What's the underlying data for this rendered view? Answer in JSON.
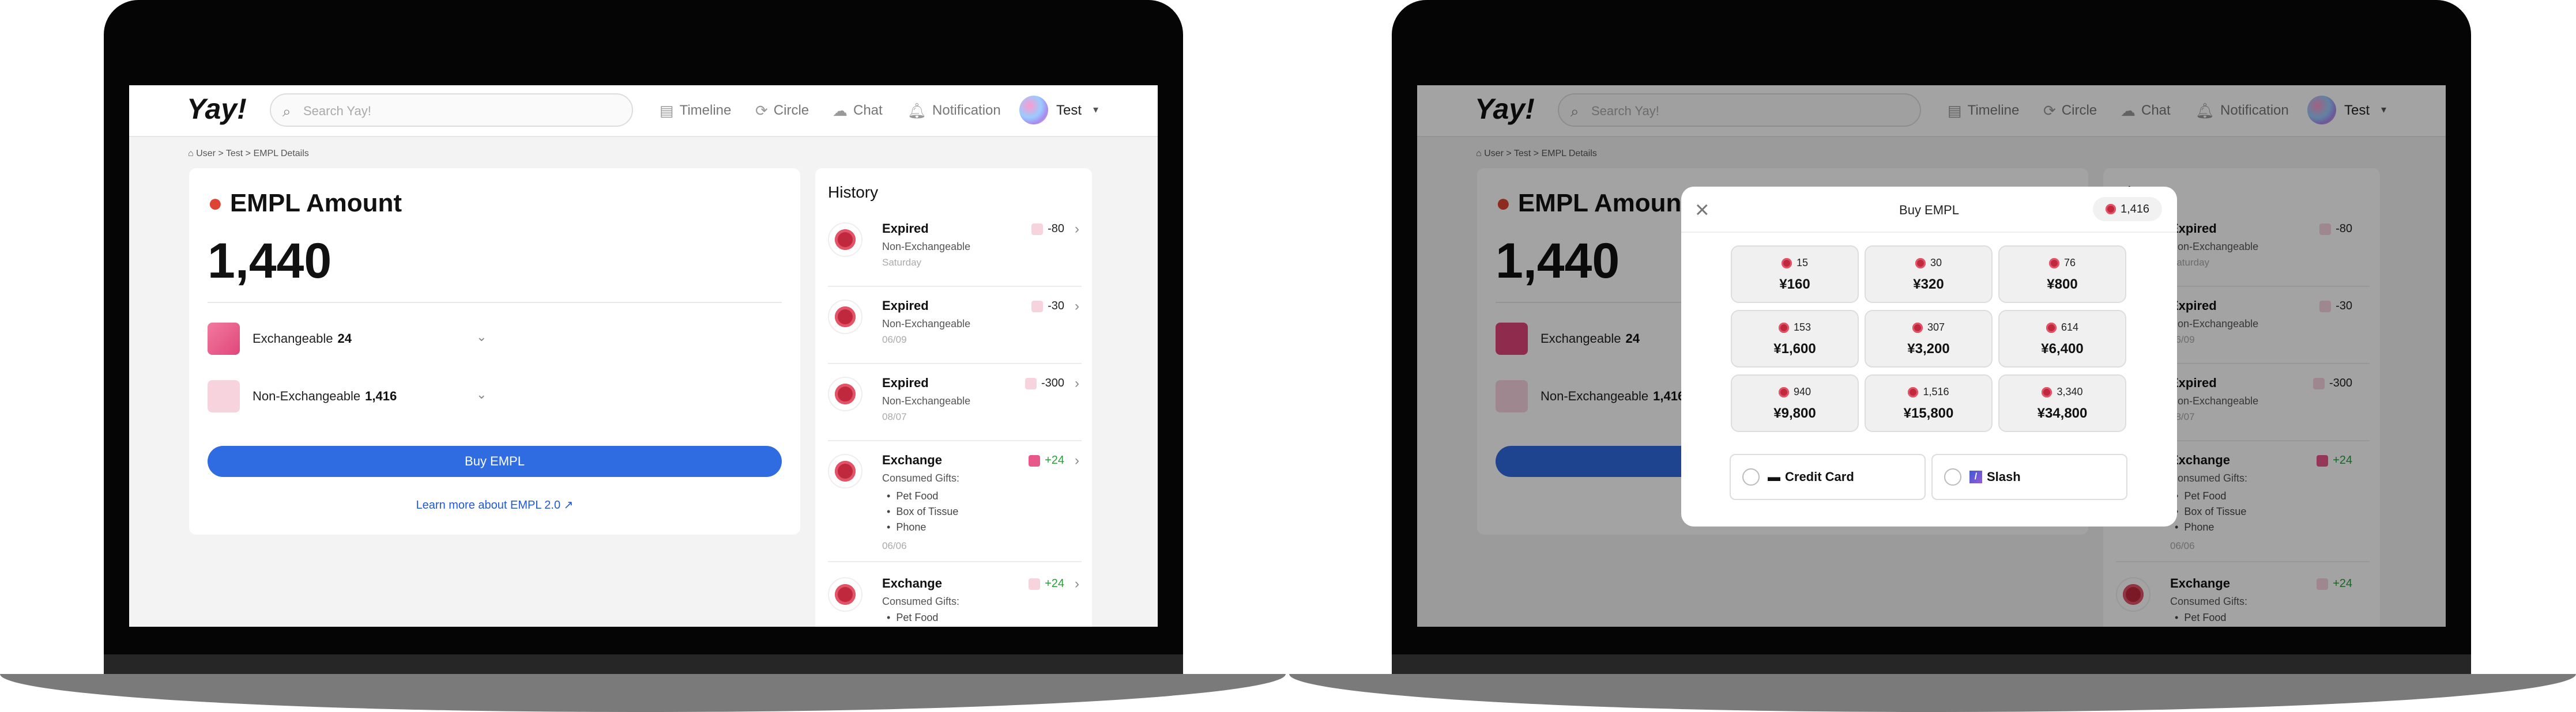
{
  "topbar": {
    "logo": "Yay!",
    "search_placeholder": "Search Yay!",
    "nav": [
      {
        "label": "Timeline",
        "icon": "timeline-icon"
      },
      {
        "label": "Circle",
        "icon": "circle-icon"
      },
      {
        "label": "Chat",
        "icon": "chat-icon"
      },
      {
        "label": "Notification",
        "icon": "bell-icon"
      }
    ],
    "user": "Test"
  },
  "breadcrumb": [
    "User",
    "Test",
    "EMPL Details"
  ],
  "empl": {
    "title": "EMPL Amount",
    "total": "1,440",
    "exchangeable_label": "Exchangeable",
    "exchangeable_value": "24",
    "non_exchangeable_label": "Non-Exchangeable",
    "non_exchangeable_value": "1,416",
    "buy_label": "Buy EMPL",
    "learn_label": "Learn more about EMPL 2.0"
  },
  "history": {
    "title": "History",
    "items": [
      {
        "name": "Expired",
        "sub": "Non-Exchangeable",
        "date": "Saturday",
        "amount": "-80"
      },
      {
        "name": "Expired",
        "sub": "Non-Exchangeable",
        "date": "06/09",
        "amount": "-30"
      },
      {
        "name": "Expired",
        "sub": "Non-Exchangeable",
        "date": "08/07",
        "amount": "-300"
      },
      {
        "name": "Exchange",
        "sub": "Consumed Gifts:",
        "gifts": [
          "Pet Food",
          "Box of Tissue",
          "Phone"
        ],
        "date": "06/06",
        "amount": "+24"
      },
      {
        "name": "Exchange",
        "sub": "Consumed Gifts:",
        "gifts": [
          "Pet Food"
        ],
        "date": "",
        "amount": "+24"
      }
    ]
  },
  "modal": {
    "title": "Buy EMPL",
    "balance": "1,416",
    "options": [
      {
        "amount": "15",
        "price": "¥160"
      },
      {
        "amount": "30",
        "price": "¥320"
      },
      {
        "amount": "76",
        "price": "¥800"
      },
      {
        "amount": "153",
        "price": "¥1,600"
      },
      {
        "amount": "307",
        "price": "¥3,200"
      },
      {
        "amount": "614",
        "price": "¥6,400"
      },
      {
        "amount": "940",
        "price": "¥9,800"
      },
      {
        "amount": "1,516",
        "price": "¥15,800"
      },
      {
        "amount": "3,340",
        "price": "¥34,800"
      }
    ],
    "payment": {
      "credit": "Credit Card",
      "slash": "Slash"
    }
  },
  "colors": {
    "accent": "#2f6be1",
    "positive": "#2a9d3a",
    "exchangeable": "#e8578a",
    "non_exchangeable": "#f7ced9",
    "coin": "#c0283d"
  }
}
